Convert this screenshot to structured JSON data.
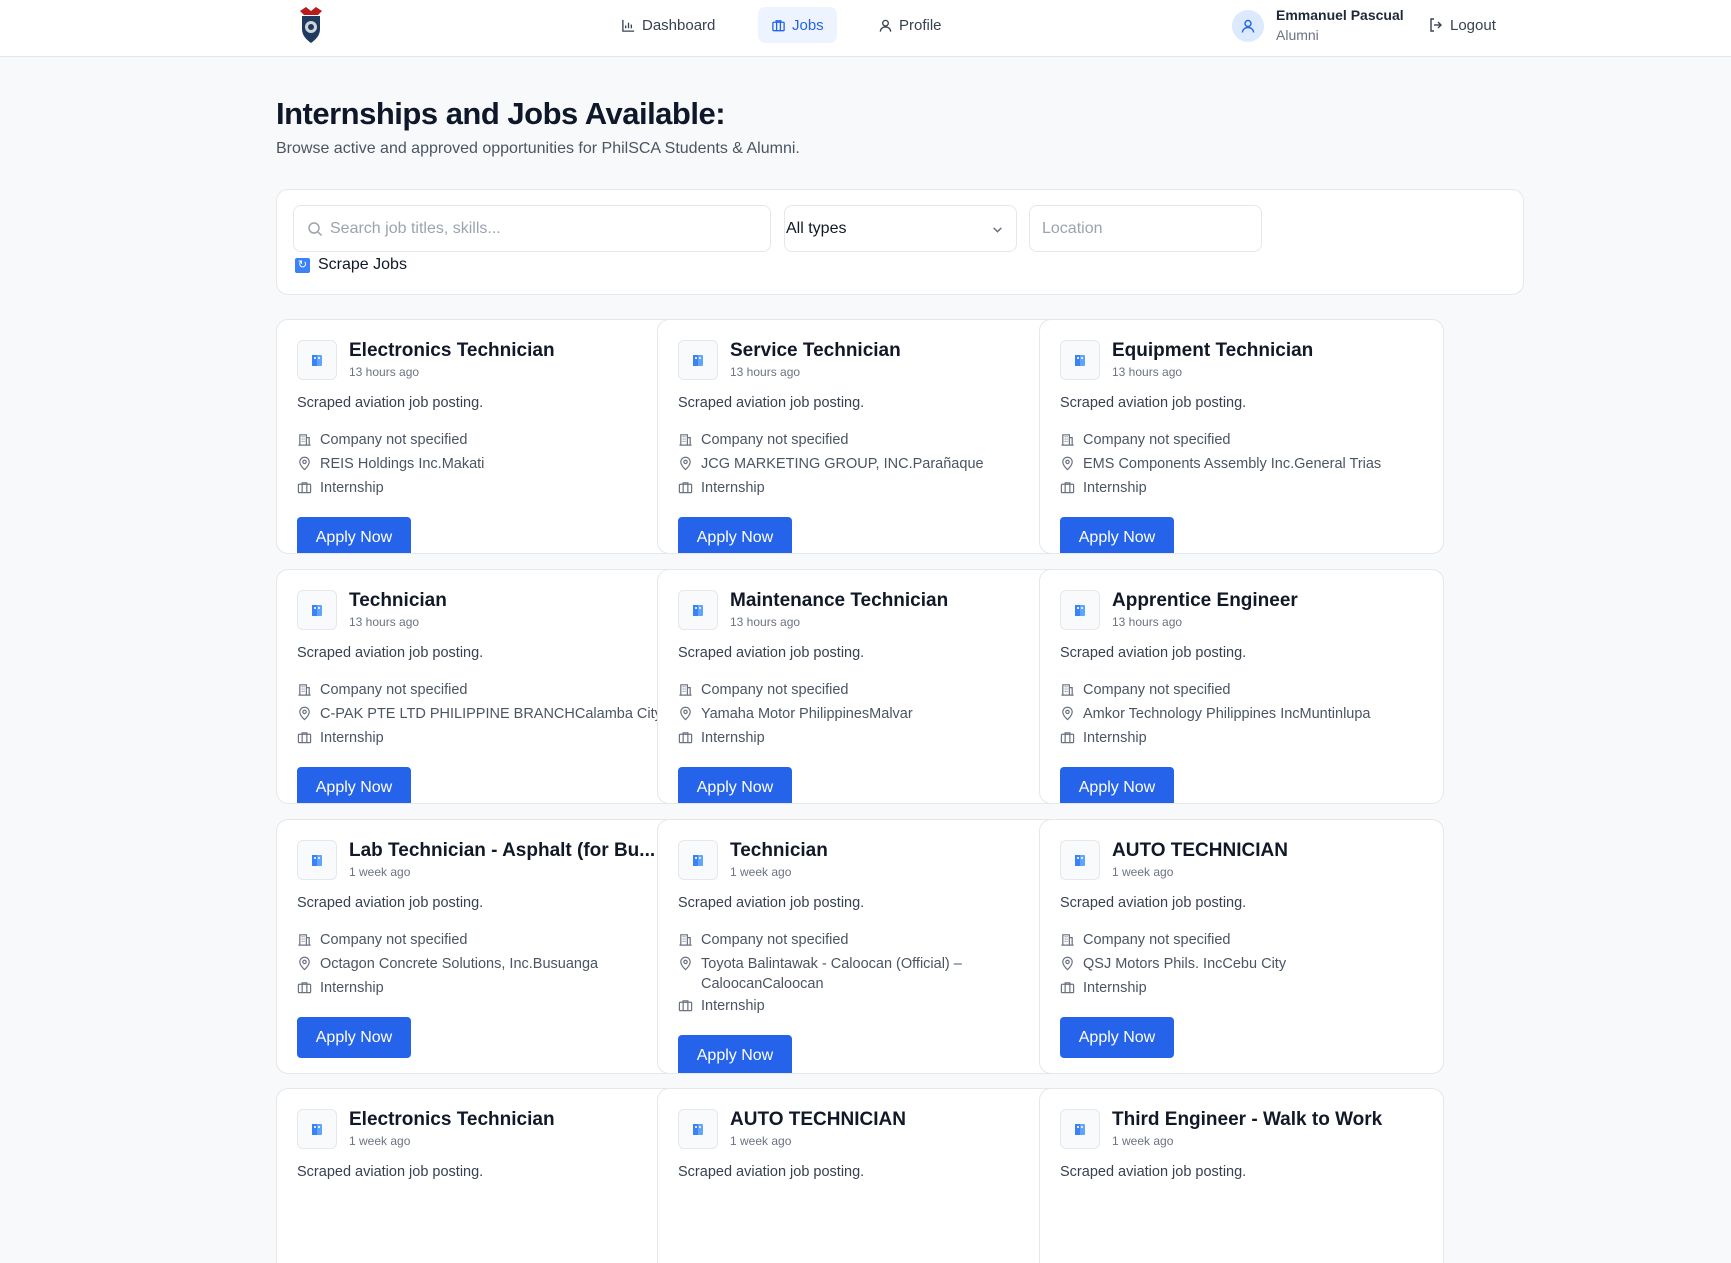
{
  "nav": {
    "items": [
      {
        "label": "Dashboard",
        "icon": "bar-chart-icon"
      },
      {
        "label": "Jobs",
        "icon": "briefcase-icon"
      },
      {
        "label": "Profile",
        "icon": "user-icon"
      }
    ],
    "active": "Jobs",
    "accent_color": "#2563eb"
  },
  "user": {
    "name": "Emmanuel Pascual",
    "role": "Alumni",
    "logout_label": "Logout"
  },
  "page": {
    "title": "Internships and Jobs Available:",
    "subtitle": "Browse active and approved opportunities for PhilSCA Students & Alumni."
  },
  "filters": {
    "search_placeholder": "Search job titles, skills...",
    "search_value": "",
    "type_selected": "All types",
    "location_placeholder": "Location",
    "location_value": "",
    "scrape_label": "Scrape Jobs"
  },
  "apply_label": "Apply Now",
  "jobs": [
    {
      "title": "Electronics Technician",
      "posted": "13 hours ago",
      "description": "Scraped aviation job posting.",
      "company": "Company not specified",
      "location": "REIS Holdings Inc.Makati",
      "type": "Internship"
    },
    {
      "title": "Service Technician",
      "posted": "13 hours ago",
      "description": "Scraped aviation job posting.",
      "company": "Company not specified",
      "location": "JCG MARKETING GROUP, INC.Parañaque",
      "type": "Internship"
    },
    {
      "title": "Equipment Technician",
      "posted": "13 hours ago",
      "description": "Scraped aviation job posting.",
      "company": "Company not specified",
      "location": "EMS Components Assembly Inc.General Trias",
      "type": "Internship"
    },
    {
      "title": "Technician",
      "posted": "13 hours ago",
      "description": "Scraped aviation job posting.",
      "company": "Company not specified",
      "location": "C-PAK PTE LTD PHILIPPINE BRANCHCalamba City",
      "type": "Internship"
    },
    {
      "title": "Maintenance Technician",
      "posted": "13 hours ago",
      "description": "Scraped aviation job posting.",
      "company": "Company not specified",
      "location": "Yamaha Motor PhilippinesMalvar",
      "type": "Internship"
    },
    {
      "title": "Apprentice Engineer",
      "posted": "13 hours ago",
      "description": "Scraped aviation job posting.",
      "company": "Company not specified",
      "location": "Amkor Technology Philippines IncMuntinlupa",
      "type": "Internship"
    },
    {
      "title": "Lab Technician - Asphalt (for Bu...",
      "posted": "1 week ago",
      "description": "Scraped aviation job posting.",
      "company": "Company not specified",
      "location": "Octagon Concrete Solutions, Inc.Busuanga",
      "type": "Internship"
    },
    {
      "title": "Technician",
      "posted": "1 week ago",
      "description": "Scraped aviation job posting.",
      "company": "Company not specified",
      "location": "Toyota Balintawak - Caloocan (Official) – CaloocanCaloocan",
      "type": "Internship"
    },
    {
      "title": "AUTO TECHNICIAN",
      "posted": "1 week ago",
      "description": "Scraped aviation job posting.",
      "company": "Company not specified",
      "location": "QSJ Motors Phils. IncCebu City",
      "type": "Internship"
    },
    {
      "title": "Electronics Technician",
      "posted": "1 week ago",
      "description": "Scraped aviation job posting."
    },
    {
      "title": "AUTO TECHNICIAN",
      "posted": "1 week ago",
      "description": "Scraped aviation job posting."
    },
    {
      "title": "Third Engineer - Walk to Work",
      "posted": "1 week ago",
      "description": "Scraped aviation job posting."
    }
  ]
}
